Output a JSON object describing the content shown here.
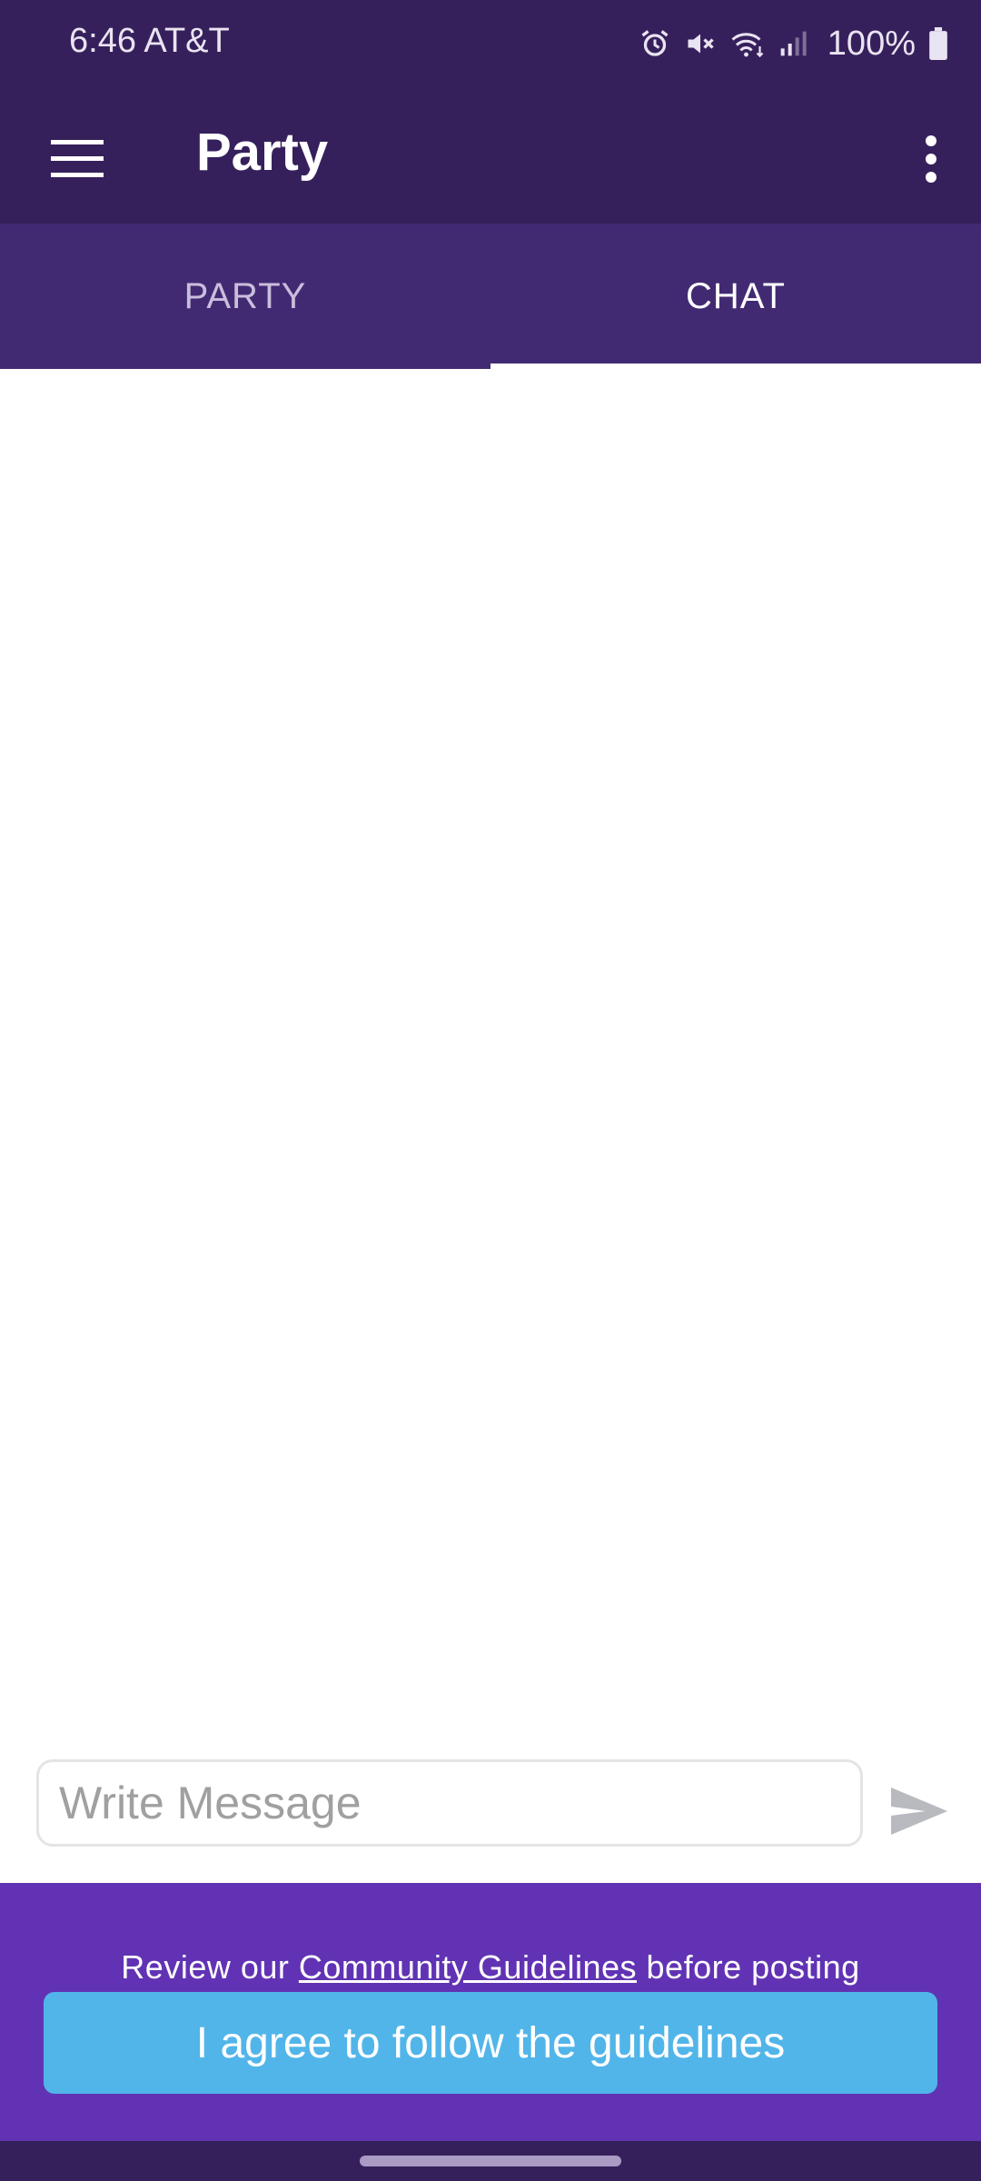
{
  "status_bar": {
    "time_carrier": "6:46 AT&T",
    "battery": "100%",
    "icons": [
      "alarm-icon",
      "mute-icon",
      "wifi-icon",
      "signal-icon",
      "battery-icon"
    ]
  },
  "app_bar": {
    "title": "Party",
    "menu_icon": "hamburger-menu-icon",
    "overflow_icon": "more-vert-icon"
  },
  "tabs": [
    {
      "label": "PARTY",
      "active": false
    },
    {
      "label": "CHAT",
      "active": true
    }
  ],
  "composer": {
    "value": "",
    "placeholder": "Write Message",
    "send_icon": "send-icon"
  },
  "guidelines": {
    "prefix": "Review our ",
    "link": "Community Guidelines",
    "suffix": " before posting",
    "button_label": "I agree to follow the guidelines"
  },
  "colors": {
    "header": "#36205c",
    "tabs": "#422a73",
    "banner": "#6133b4",
    "agree_button": "#51b5e9"
  }
}
